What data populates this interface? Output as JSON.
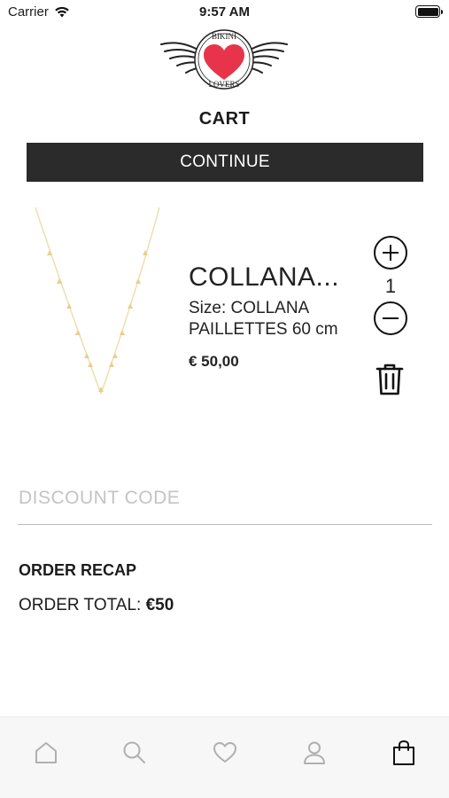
{
  "status_bar": {
    "carrier": "Carrier",
    "time": "9:57 AM"
  },
  "logo": {
    "brand_top": "BIKINI",
    "brand_bottom": "LOVERS"
  },
  "page": {
    "title": "CART"
  },
  "actions": {
    "continue_label": "CONTINUE"
  },
  "cart_item": {
    "name": "COLLANA...",
    "size_line1": "Size: COLLANA",
    "size_line2": "PAILLETTES 60 cm",
    "price": "€ 50,00",
    "quantity": "1"
  },
  "discount": {
    "placeholder": "DISCOUNT CODE",
    "value": ""
  },
  "recap": {
    "title": "ORDER RECAP",
    "total_label": "ORDER TOTAL:",
    "total_value": "€50"
  },
  "tab_bar": {
    "items": [
      "home-icon",
      "search-icon",
      "heart-icon",
      "user-icon",
      "bag-icon"
    ],
    "active": "bag-icon"
  },
  "colors": {
    "button_bg": "#2b2b2b",
    "logo_heart": "#e8344a",
    "product_gold": "#e9d79a"
  }
}
